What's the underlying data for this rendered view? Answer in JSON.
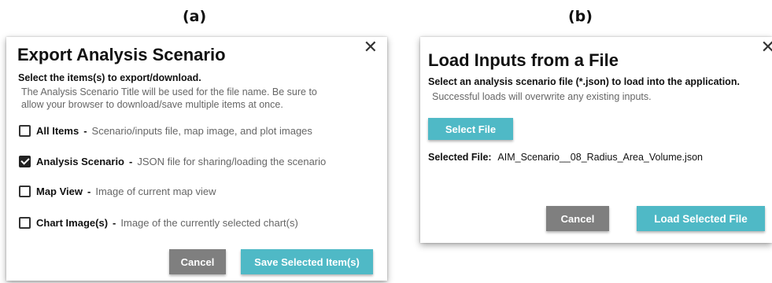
{
  "panel_labels": {
    "a": "(a)",
    "b": "(b)"
  },
  "export_dialog": {
    "title": "Export Analysis Scenario",
    "subtitle": "Select the items(s) to export/download.",
    "description_line1": "The Analysis Scenario Title will be used for the file name.  Be sure to",
    "description_line2": "allow your browser to download/save multiple items at once.",
    "close_glyph": "✕",
    "options": [
      {
        "name": "All Items",
        "dash": "-",
        "desc": "Scenario/inputs file, map image, and plot images",
        "checked": false
      },
      {
        "name": "Analysis Scenario",
        "dash": "-",
        "desc": "JSON file for sharing/loading the scenario",
        "checked": true
      },
      {
        "name": "Map View",
        "dash": "-",
        "desc": "Image of current map view",
        "checked": false
      },
      {
        "name": "Chart Image(s)",
        "dash": "-",
        "desc": "Image of the currently selected chart(s)",
        "checked": false
      }
    ],
    "cancel_label": "Cancel",
    "save_label": "Save Selected Item(s)"
  },
  "load_dialog": {
    "title": "Load Inputs from a File",
    "subtitle": "Select an analysis scenario file (*.json) to load into the application.",
    "description": "Successful loads will overwrite any existing inputs.",
    "close_glyph": "✕",
    "select_file_label": "Select File",
    "selected_file_label": "Selected File:",
    "selected_file_value": "AIM_Scenario__08_Radius_Area_Volume.json",
    "cancel_label": "Cancel",
    "load_label": "Load Selected File"
  },
  "colors": {
    "teal_button": "#4fb9c6",
    "grey_button": "#7f7f7f"
  }
}
